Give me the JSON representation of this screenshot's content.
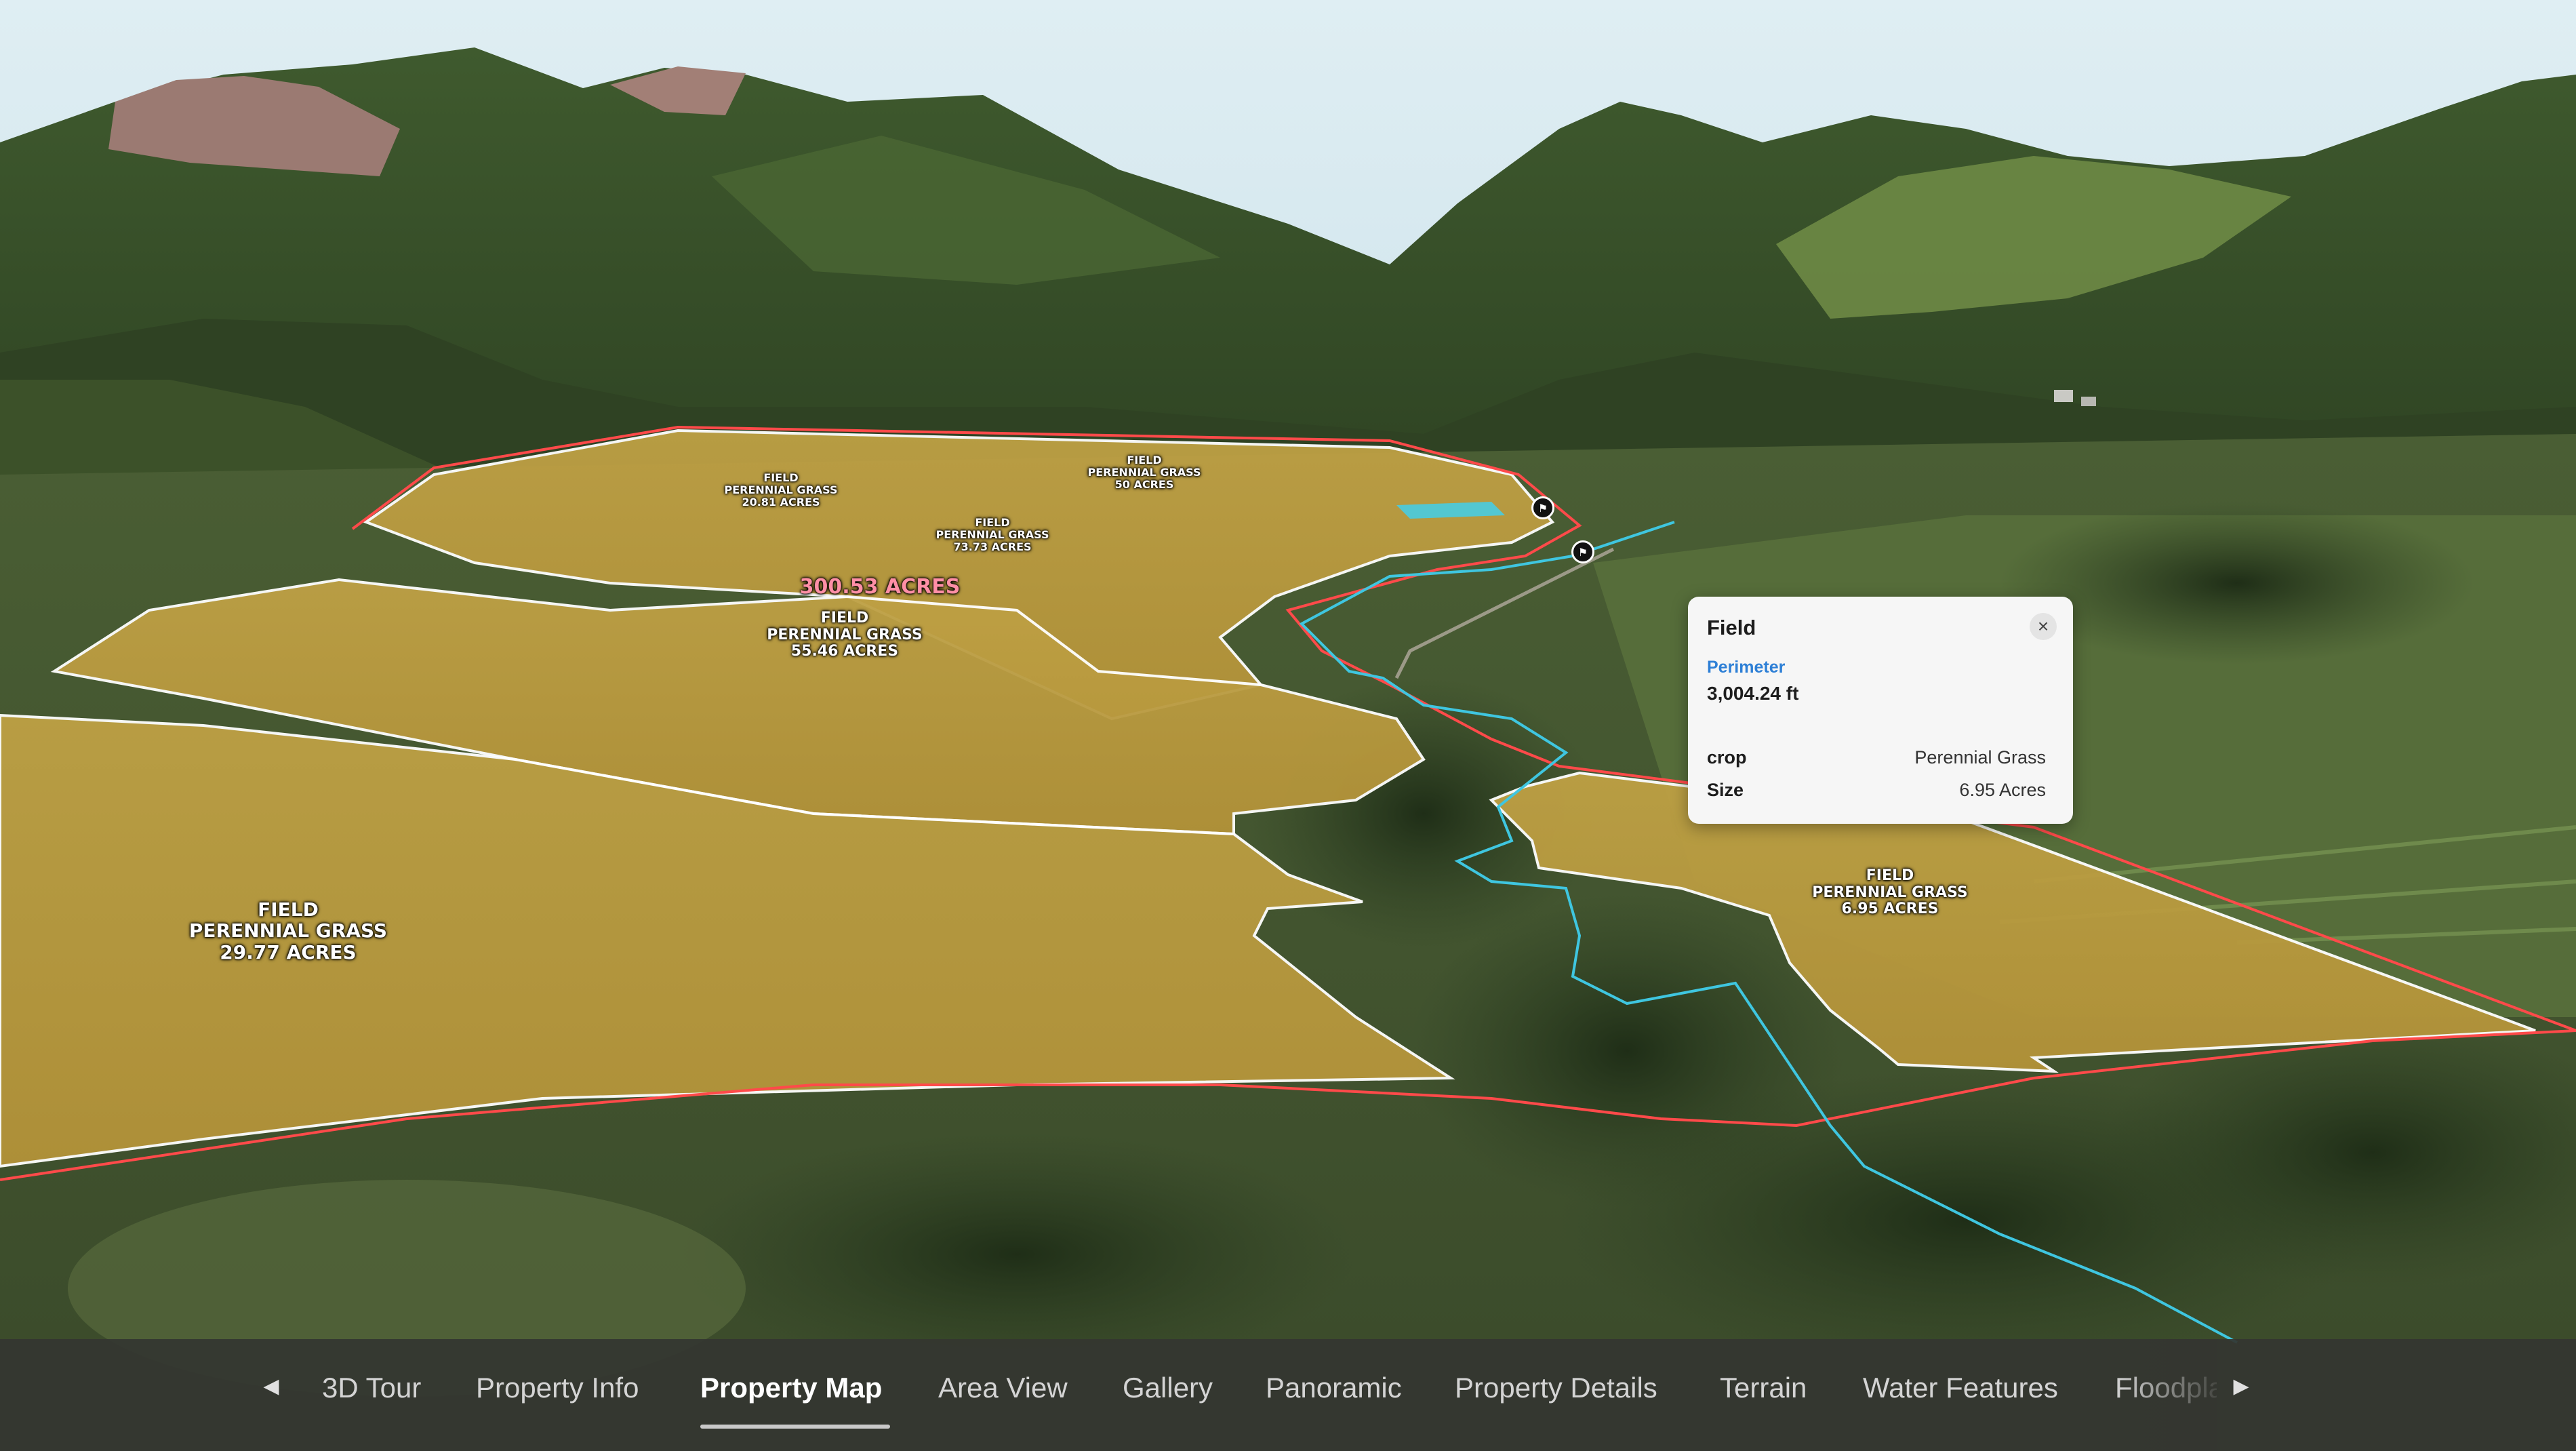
{
  "map": {
    "total_label": "300.53 ACRES",
    "fields": [
      {
        "id": "a",
        "lines": [
          "FIELD",
          "PERENNIAL GRASS",
          "20.81 ACRES"
        ]
      },
      {
        "id": "b",
        "lines": [
          "FIELD",
          "PERENNIAL GRASS",
          "50 ACRES"
        ]
      },
      {
        "id": "c",
        "lines": [
          "FIELD",
          "PERENNIAL GRASS",
          "73.73 ACRES"
        ]
      },
      {
        "id": "d",
        "lines": [
          "FIELD",
          "PERENNIAL GRASS",
          "55.46 ACRES"
        ]
      },
      {
        "id": "e",
        "lines": [
          "FIELD",
          "PERENNIAL GRASS",
          "29.77 ACRES"
        ]
      },
      {
        "id": "f",
        "lines": [
          "FIELD",
          "PERENNIAL GRASS",
          "6.95 ACRES"
        ]
      }
    ],
    "colors": {
      "field_fill": "#b89a3e",
      "property_boundary": "#ff4a4a",
      "field_outline": "#ffffff",
      "creek": "#3fc6e0"
    }
  },
  "popup": {
    "title": "Field",
    "close_icon": "close-icon",
    "metric_label": "Perimeter",
    "metric_value": "3,004.24 ft",
    "rows": [
      {
        "key": "crop",
        "value": "Perennial Grass"
      },
      {
        "key": "Size",
        "value": "6.95 Acres"
      }
    ],
    "accent_color": "#2d7fd6"
  },
  "nav": {
    "prev_icon": "chevron-left-icon",
    "next_icon": "chevron-right-icon",
    "tabs": [
      {
        "label": "3D Tour"
      },
      {
        "label": "Property Info"
      },
      {
        "label": "Property Map",
        "active": true
      },
      {
        "label": "Area View"
      },
      {
        "label": "Gallery"
      },
      {
        "label": "Panoramic"
      },
      {
        "label": "Property Details"
      },
      {
        "label": "Terrain"
      },
      {
        "label": "Water Features"
      },
      {
        "label": "Floodplain"
      }
    ]
  }
}
